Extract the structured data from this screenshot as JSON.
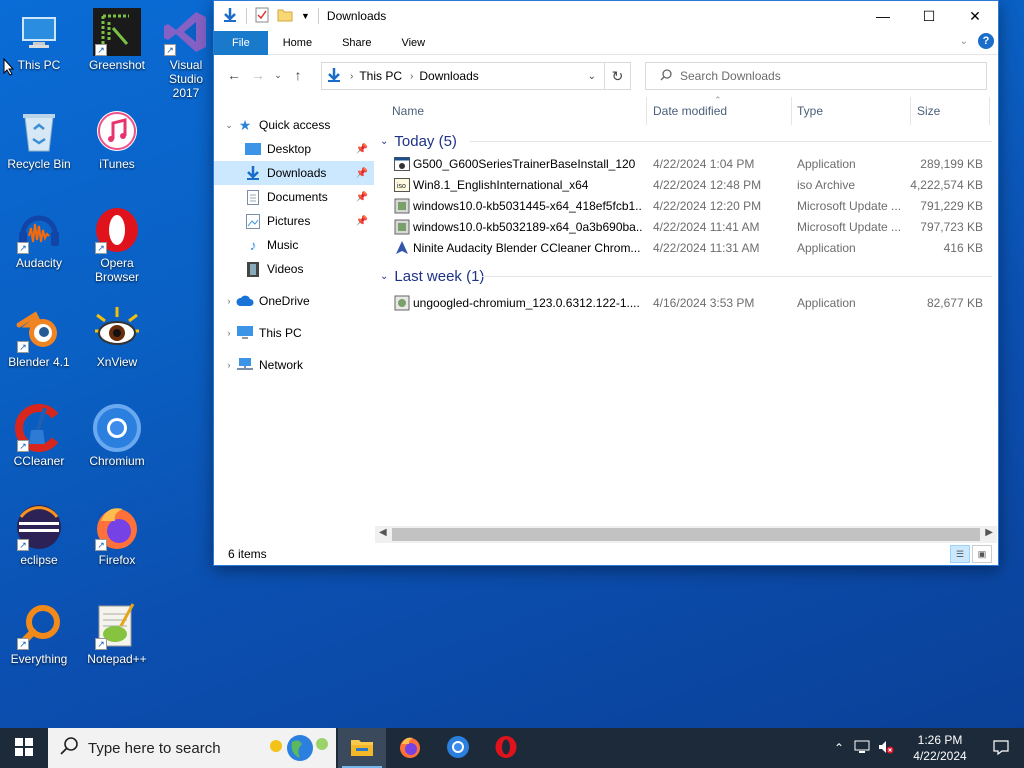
{
  "desktop": {
    "icons": [
      {
        "label": "This PC"
      },
      {
        "label": "Greenshot"
      },
      {
        "label": "Visual Studio 2017"
      },
      {
        "label": "Recycle Bin"
      },
      {
        "label": "iTunes"
      },
      {
        "label": "Audacity"
      },
      {
        "label": "Opera Browser"
      },
      {
        "label": "Blender 4.1"
      },
      {
        "label": "XnView"
      },
      {
        "label": "CCleaner"
      },
      {
        "label": "Chromium"
      },
      {
        "label": "eclipse"
      },
      {
        "label": "Firefox"
      },
      {
        "label": "Everything"
      },
      {
        "label": "Notepad++"
      }
    ]
  },
  "window": {
    "title": "Downloads",
    "ribbon_tabs": [
      "File",
      "Home",
      "Share",
      "View"
    ],
    "help_label": "?",
    "breadcrumb": [
      "This PC",
      "Downloads"
    ],
    "search_placeholder": "Search Downloads",
    "nav": {
      "quick_access": "Quick access",
      "pinned": [
        "Desktop",
        "Downloads",
        "Documents",
        "Pictures"
      ],
      "others": [
        "Music",
        "Videos"
      ],
      "onedrive": "OneDrive",
      "this_pc": "This PC",
      "network": "Network"
    },
    "columns": {
      "name": "Name",
      "date": "Date modified",
      "type": "Type",
      "size": "Size"
    },
    "groups": [
      {
        "label": "Today (5)",
        "files": [
          {
            "name": "G500_G600SeriesTrainerBaseInstall_120",
            "date": "4/22/2024 1:04 PM",
            "type": "Application",
            "size": "289,199 KB"
          },
          {
            "name": "Win8.1_EnglishInternational_x64",
            "date": "4/22/2024 12:48 PM",
            "type": "iso Archive",
            "size": "4,222,574 KB"
          },
          {
            "name": "windows10.0-kb5031445-x64_418ef5fcb1...",
            "date": "4/22/2024 12:20 PM",
            "type": "Microsoft Update ...",
            "size": "791,229 KB"
          },
          {
            "name": "windows10.0-kb5032189-x64_0a3b690ba...",
            "date": "4/22/2024 11:41 AM",
            "type": "Microsoft Update ...",
            "size": "797,723 KB"
          },
          {
            "name": "Ninite Audacity Blender CCleaner Chrom...",
            "date": "4/22/2024 11:31 AM",
            "type": "Application",
            "size": "416 KB"
          }
        ]
      },
      {
        "label": "Last week (1)",
        "files": [
          {
            "name": "ungoogled-chromium_123.0.6312.122-1....",
            "date": "4/16/2024 3:53 PM",
            "type": "Application",
            "size": "82,677 KB"
          }
        ]
      }
    ],
    "status": "6 items"
  },
  "taskbar": {
    "search_placeholder": "Type here to search",
    "time": "1:26 PM",
    "date": "4/22/2024"
  }
}
